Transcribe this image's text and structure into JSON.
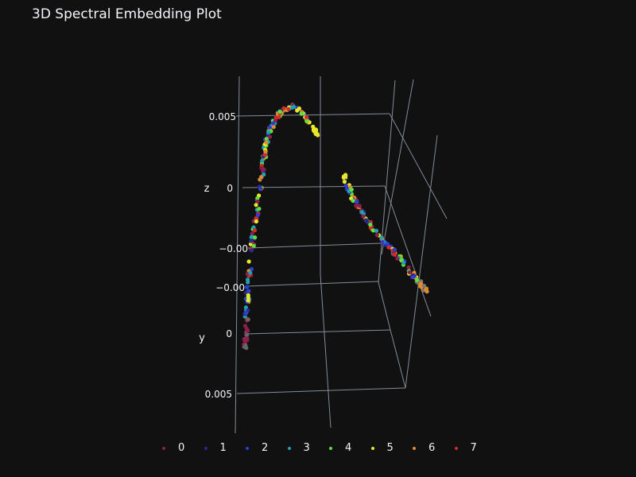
{
  "chart_data": {
    "type": "scatter",
    "title": "3D Spectral Embedding Plot",
    "axis_titles": {
      "y": "y",
      "z": "z"
    },
    "z_ticks": [
      "0.005",
      "0",
      "−0.00",
      "−0.00"
    ],
    "y_ticks": [
      "0",
      "0.005"
    ],
    "grid": true,
    "legend_position": "bottom",
    "series": [
      {
        "name": "0",
        "color": "#8b1e4a"
      },
      {
        "name": "1",
        "color": "#2a2a8c"
      },
      {
        "name": "2",
        "color": "#2b3fd6"
      },
      {
        "name": "3",
        "color": "#1fa1b0"
      },
      {
        "name": "4",
        "color": "#5fe03a"
      },
      {
        "name": "5",
        "color": "#e8e82a"
      },
      {
        "name": "6",
        "color": "#e08a2c"
      },
      {
        "name": "7",
        "color": "#d42a2a"
      }
    ]
  }
}
